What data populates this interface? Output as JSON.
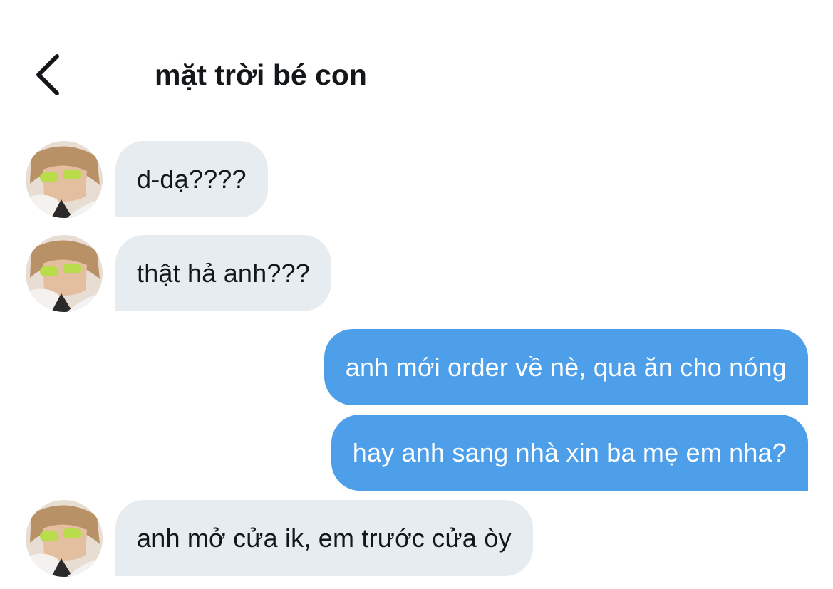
{
  "header": {
    "back_icon": "chevron-left-icon",
    "title": "mặt trời bé con"
  },
  "conversation": {
    "messages": [
      {
        "from": "contact",
        "text": "d-dạ????"
      },
      {
        "from": "contact",
        "text": "thật hả anh???"
      },
      {
        "from": "me",
        "text": "anh mới order về nè, qua ăn cho nóng"
      },
      {
        "from": "me",
        "text": "hay anh sang nhà xin ba mẹ em nha?"
      },
      {
        "from": "contact",
        "text": "anh mở cửa ik, em trước cửa òy"
      }
    ]
  },
  "colors": {
    "received_bubble": "#e6ecf0",
    "sent_bubble": "#4d9fe9",
    "text_dark": "#14171a",
    "text_light": "#ffffff"
  }
}
